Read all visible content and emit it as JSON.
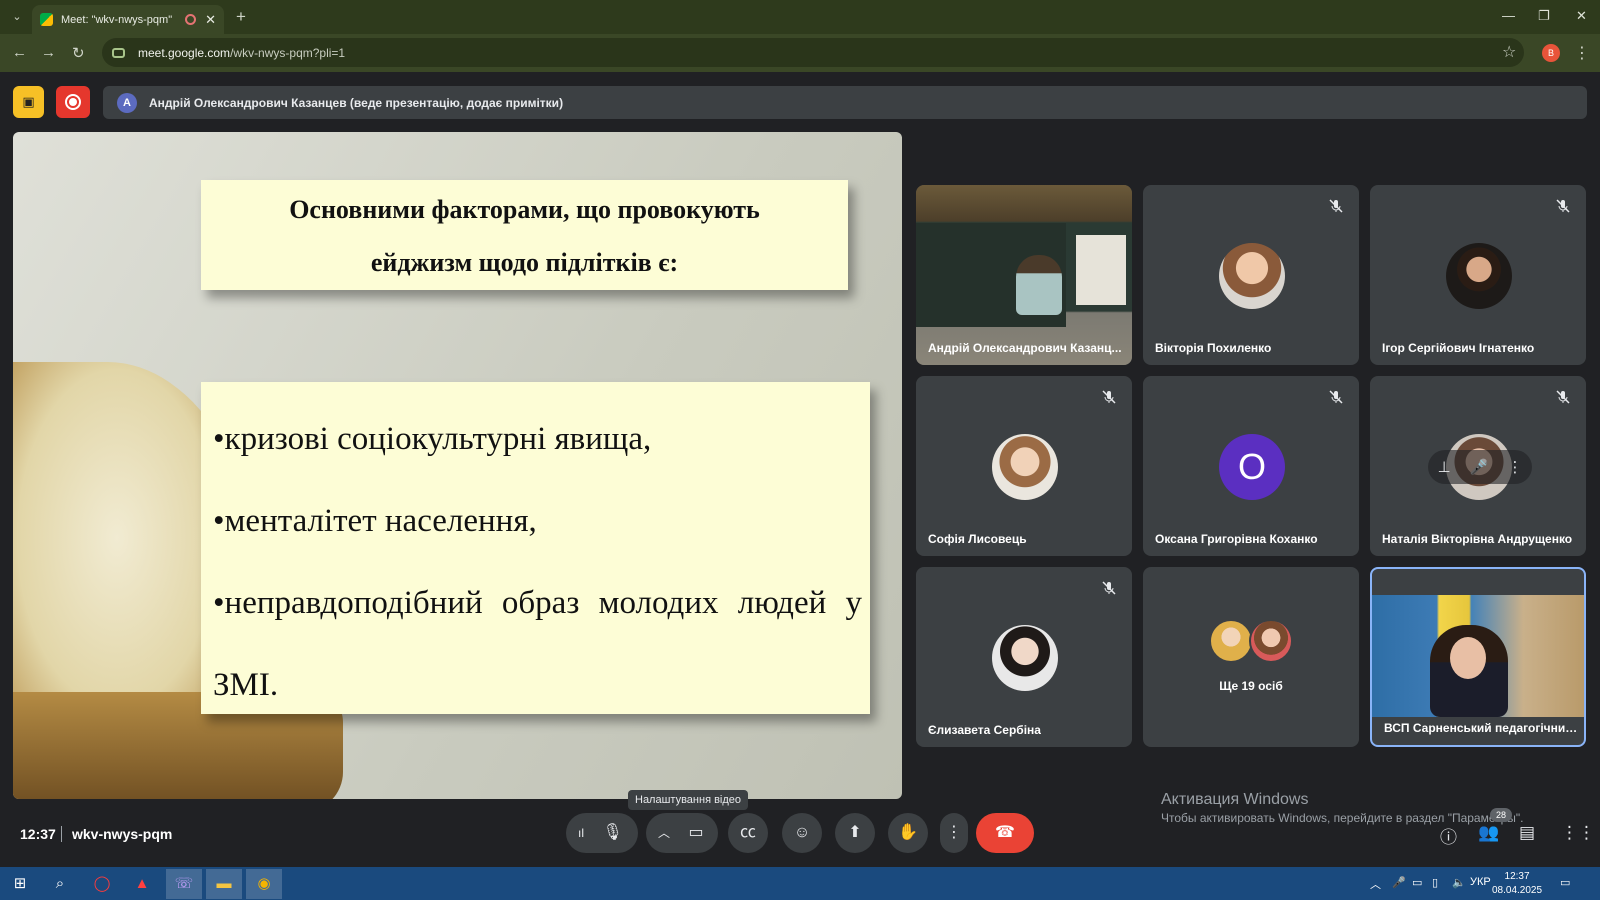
{
  "browser": {
    "tab_title": "Meet: \"wkv-nwys-pqm\"",
    "url_host": "meet.google.com",
    "url_path": "/wkv-nwys-pqm?pli=1",
    "profile_initial": "B",
    "new_tab": "+"
  },
  "meet": {
    "presenter_initial": "A",
    "presenter_banner": "Андрій Олександрович Казанцев (веде презентацію, додає примітки)",
    "slide": {
      "title_line1": "Основними факторами, що провокують",
      "title_line2": "ейджизм щодо підлітків є:",
      "bullet1": "•кризові соціокультурні явища,",
      "bullet2": "•менталітет населення,",
      "bullet3": "•неправдоподібний образ молодих людей у",
      "bullet4": "ЗМІ."
    },
    "participants": [
      {
        "name": "Андрій Олександрович Казанц...",
        "muted": false
      },
      {
        "name": "Вікторія Похиленко",
        "muted": true
      },
      {
        "name": "Ігор Сергійович Ігнатенко",
        "muted": true
      },
      {
        "name": "Софія Лисовець",
        "muted": true
      },
      {
        "name": "Оксана Григорівна Коханко",
        "muted": true,
        "initial": "О"
      },
      {
        "name": "Наталія Вікторівна Андрущенко",
        "muted": true
      },
      {
        "name": "Єлизавета Сербіна",
        "muted": true
      },
      {
        "name": "ВСП Сарненський педагогічний...",
        "muted": false
      }
    ],
    "more_people": "Ще 19 осіб",
    "time": "12:37",
    "meeting_code": "wkv-nwys-pqm",
    "tooltip": "Налаштування відео",
    "people_count": "28",
    "colors": {
      "accent_red": "#ea4335",
      "record_red": "#e5372d",
      "active_border": "#8ab4f8"
    }
  },
  "watermark": {
    "line1": "Активация Windows",
    "line2": "Чтобы активировать Windows, перейдите в раздел \"Параметры\"."
  },
  "taskbar": {
    "lang": "УКР",
    "time": "12:37",
    "date": "08.04.2025"
  }
}
